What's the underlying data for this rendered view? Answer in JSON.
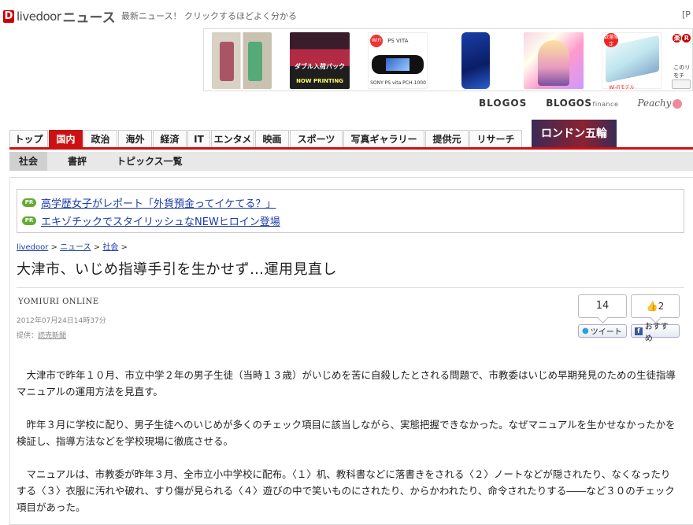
{
  "header": {
    "logo_mark": "D",
    "logo_text": "livedoor",
    "logo_news": "ニュース",
    "tagline": "最新ニュース！ クリックするほどよく分かる",
    "corner": "[P"
  },
  "banner": {
    "p2_label": "ダブル入荷パック",
    "p2_label2": "NOW PRINTING",
    "p3_wifi": "WiFi",
    "p3_brand": "PS VITA",
    "p3_caption": "SONY PS vita PCH-1000",
    "p6_badge": "数量限定",
    "p6_caption": "Wi-Fiモデル",
    "rakuten_label": "楽",
    "rakuten_badge": "R",
    "rakuten_line1": "このリ",
    "rakuten_line2": "をチ"
  },
  "brands": {
    "blogos": "BLOGOS",
    "blogos_finance": "BLOGOS",
    "finance_suffix": "finance",
    "peachy": "Peachy"
  },
  "nav": {
    "tabs": [
      "トップ",
      "国内",
      "政治",
      "海外",
      "経済",
      "IT",
      "エンタメ",
      "映画",
      "スポーツ",
      "写真ギャラリー",
      "提供元",
      "リサーチ"
    ],
    "olympic": "ロンドン五輪"
  },
  "subnav": {
    "items": [
      "社会",
      "書評",
      "トピックス一覧"
    ]
  },
  "pr": {
    "badge": "PR",
    "links": [
      "高学歴女子がレポート「外貨預金ってイケてる？」",
      "エキゾチックでスタイリッシュなNEWヒロイン登場"
    ]
  },
  "breadcrumb": {
    "home": "livedoor",
    "news": "ニュース",
    "section": "社会",
    "sep": " > "
  },
  "article": {
    "title": "大津市、いじめ指導手引を生かせず…運用見直し",
    "source": "YOMIURI ONLINE",
    "date": "2012年07月24日14時37分",
    "provider_label": "提供：",
    "provider": "読売新聞",
    "paragraphs": [
      "大津市で昨年１０月、市立中学２年の男子生徒（当時１３歳）がいじめを苦に自殺したとされる問題で、市教委はいじめ早期発見のための生徒指導マニュアルの運用方法を見直す。",
      "昨年３月に学校に配り、男子生徒へのいじめが多くのチェック項目に該当しながら、実態把握できなかった。なぜマニュアルを生かせなかったかを検証し、指導方法などを学校現場に徹底させる。",
      "マニュアルは、市教委が昨年３月、全市立小中学校に配布。〈１〉机、教科書などに落書きをされる〈２〉ノートなどが隠されたり、なくなったりする〈３〉衣服に汚れや破れ、すり傷が見られる〈４〉遊びの中で笑いものにされたり、からかわれたり、命令されたりする――など３０のチェック項目があった。"
    ]
  },
  "social": {
    "tweet_count": "14",
    "like_count": "2",
    "like_icon": "👍",
    "tweet_label": "ツイート",
    "like_label": "おすすめ",
    "fb_icon": "f"
  }
}
